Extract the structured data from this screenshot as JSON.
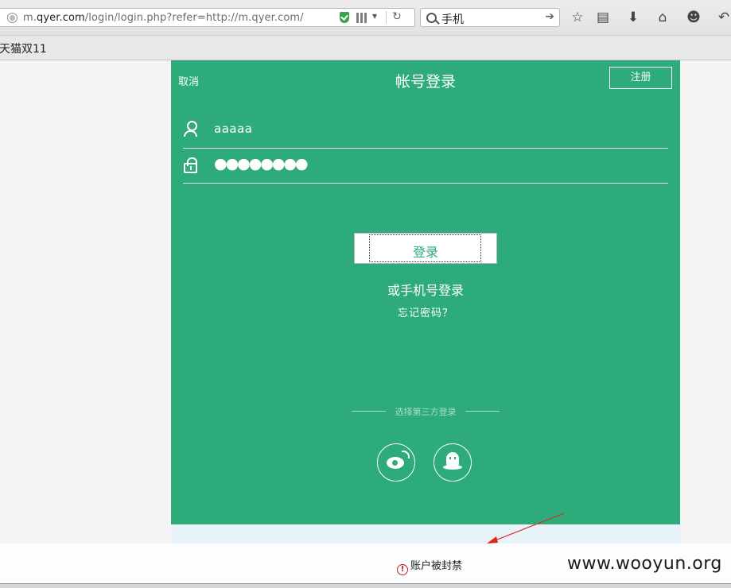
{
  "browser": {
    "url": {
      "prefix": "m.",
      "domain": "qyer.com",
      "path": "/login/login.php?refer=http://m.qyer.com/"
    },
    "search_value": "手机",
    "bookmark_label": "天猫双11"
  },
  "login": {
    "cancel_label": "取消",
    "title": "帐号登录",
    "register_label": "注册",
    "username_value": "aaaaa",
    "password_value": "●●●●●●●●",
    "login_button_label": "登录",
    "phone_login_label": "或手机号登录",
    "forgot_label": "忘记密码？",
    "third_party_label": "选择第三方登录",
    "social": [
      "weibo",
      "qq"
    ]
  },
  "toast": {
    "message": "账户被封禁"
  },
  "watermark": "www.wooyun.org",
  "colors": {
    "brand_green": "#2eab7b",
    "error_red": "#c0201a",
    "annotation_red": "#e0241b"
  }
}
